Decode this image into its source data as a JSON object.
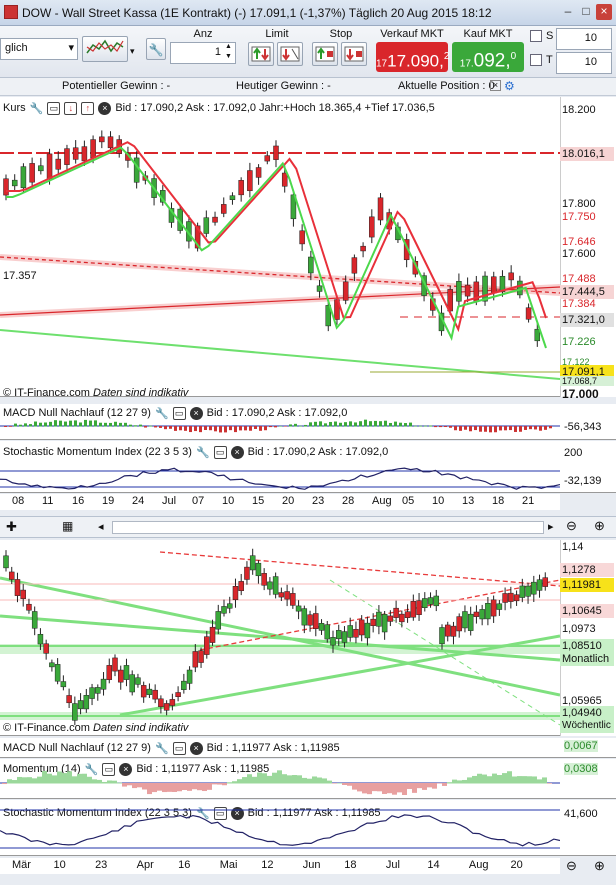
{
  "window": {
    "title": "DOW - Wall Street Kassa (1E Kontrakt) (-)   17.091,1 (-1,37%)   Täglich  20 Aug 2015 18:12"
  },
  "toolbar": {
    "period_select": "glich",
    "anz_label": "Anz",
    "anz_value": "1",
    "limit_label": "Limit",
    "stop_label": "Stop",
    "verkauf_label": "Verkauf MKT",
    "kauf_label": "Kauf MKT",
    "sell_price": "17.090,",
    "sell_sup": "2",
    "sell_small": "17",
    "buy_price": "092,",
    "buy_sup": "0",
    "buy_small": "17.",
    "s_label": "S",
    "t_label": "T",
    "s_value": "10",
    "t_value": "10",
    "sell_color": "#d9262b",
    "buy_color": "#3aa83a"
  },
  "info": {
    "potential": "Potentieller Gewinn : -",
    "today": "Heutiger Gewinn : -",
    "position": "Aktuelle Position : 0"
  },
  "top_chart": {
    "header": "Kurs",
    "header_info": "Bid : 17.090,2 Ask : 17.092,0 Jahr:+Hoch 18.365,4 +Tief 17.036,5",
    "left_label": "17.357",
    "watermark": "© IT-Finance.com",
    "indikativ": "Daten sind indikativ",
    "levels": [
      "18.200",
      "18.016,1",
      "17.800",
      "17.750",
      "17.646",
      "17.600",
      "17.488",
      "17.444,5",
      "17.384",
      "17.321,0",
      "17.226",
      "17.122",
      "17.091,1",
      "17.068,7",
      "17.000"
    ],
    "macd_header": "MACD Null Nachlauf (12 27 9)",
    "macd_info": "Bid : 17.090,2 Ask : 17.092,0",
    "macd_value": "-56,343",
    "stoch_header": "Stochastic Momentum Index (22 3 5 3)",
    "stoch_info": "Bid : 17.090,2 Ask : 17.092,0",
    "stoch_top": "200",
    "stoch_value": "-32,139",
    "xaxis": [
      "08",
      "11",
      "16",
      "19",
      "24",
      "Jul",
      "07",
      "10",
      "15",
      "20",
      "23",
      "28",
      "Aug",
      "05",
      "10",
      "13",
      "18",
      "21"
    ]
  },
  "bottom_chart": {
    "watermark": "© IT-Finance.com",
    "indikativ": "Daten sind indikativ",
    "levels": [
      "1,14",
      "1,1278",
      "1,11981",
      "1,10645",
      "1,0973",
      "1,08510",
      "Monatlich",
      "1,05965",
      "1,04940",
      "Wöchentlic"
    ],
    "macd_header": "MACD Null Nachlauf (12 27 9)",
    "macd_info": "Bid : 1,11977 Ask : 1,11985",
    "macd_value": "0,0067",
    "mom_header": "Momentum (14)",
    "mom_info": "Bid : 1,11977 Ask : 1,11985",
    "mom_value": "0,0308",
    "stoch_header": "Stochastic Momentum Index (22 3 5 3)",
    "stoch_info": "Bid : 1,11977 Ask : 1,11985",
    "stoch_value": "41,600",
    "xaxis": [
      "Mär",
      "10",
      "23",
      "Apr",
      "16",
      "Mai",
      "12",
      "Jun",
      "18",
      "Jul",
      "14",
      "Aug",
      "20"
    ]
  },
  "colors": {
    "up": "#3aa83a",
    "down": "#d9262b",
    "accent": "#2a6fd0"
  }
}
